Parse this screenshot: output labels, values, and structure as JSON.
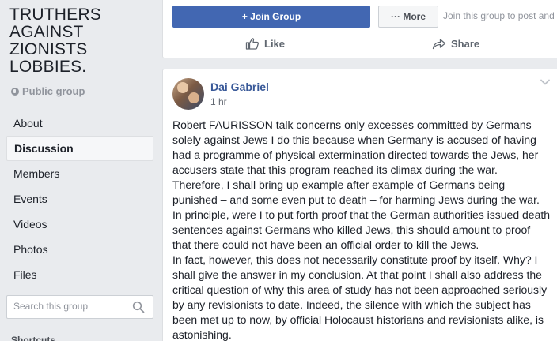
{
  "group": {
    "title": "TRUTHERS AGAINST ZIONISTS LOBBIES.",
    "type": "Public group"
  },
  "nav": {
    "items": [
      {
        "label": "About",
        "active": false
      },
      {
        "label": "Discussion",
        "active": true
      },
      {
        "label": "Members",
        "active": false
      },
      {
        "label": "Events",
        "active": false
      },
      {
        "label": "Videos",
        "active": false
      },
      {
        "label": "Photos",
        "active": false
      },
      {
        "label": "Files",
        "active": false
      }
    ]
  },
  "search": {
    "placeholder": "Search this group"
  },
  "shortcuts_label": "Shortcuts",
  "header": {
    "join_label": "+ Join Group",
    "more_label": "··· More",
    "join_hint": "Join this group to post and"
  },
  "actions": {
    "like_label": "Like",
    "share_label": "Share"
  },
  "post": {
    "author": "Dai Gabriel",
    "time": "1 hr",
    "paragraphs": [
      "Robert FAURISSON talk concerns only excesses committed by Germans solely against Jews I do this because when Germany is accused of having had a programme of physical extermination directed towards the Jews, her accusers state that this program reached its climax during the war. Therefore, I shall bring up example after example of Germans being punished – and some even put to death – for harming Jews during the war. In principle, were I to put forth proof that the German authorities issued death sentences against Germans who killed Jews, this should amount to proof that there could not have been an official order to kill the Jews.",
      "In fact, however, this does not necessarily constitute proof by itself. Why? I shall give the answer in my conclusion. At that point I shall also address the critical question of why this area of study has not been approached seriously by any revisionists to date. Indeed, the silence with which the subject has been met up to now, by official Holocaust historians and revisionists alike, is astonishing."
    ]
  },
  "colors": {
    "brand_blue": "#4267b2",
    "link_blue": "#385898",
    "page_bg": "#e9ebee"
  },
  "icons": [
    "globe-icon",
    "search-icon",
    "like-icon",
    "share-icon",
    "chevron-down-icon",
    "avatar"
  ]
}
